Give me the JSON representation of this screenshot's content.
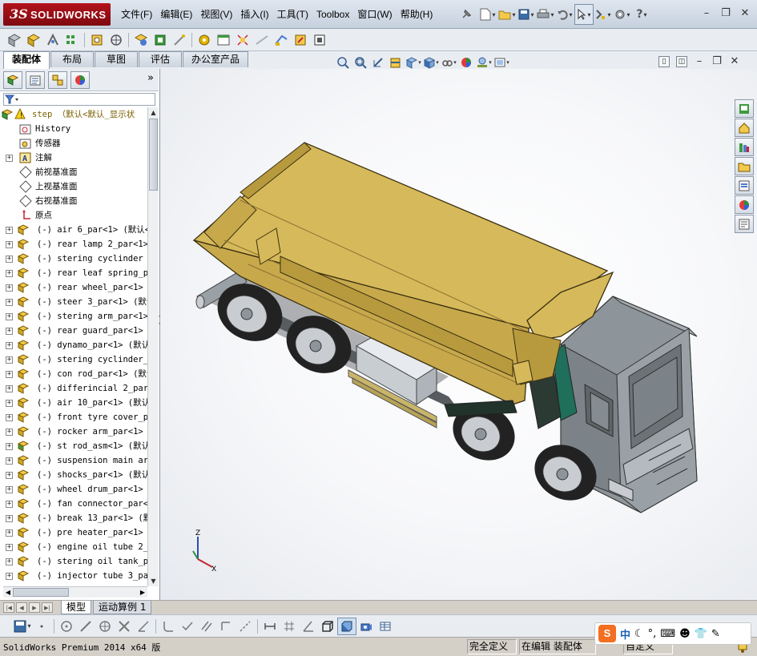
{
  "app": {
    "logo_ds": "3S",
    "logo_text": "SOLIDWORKS",
    "menus": [
      "文件(F)",
      "编辑(E)",
      "视图(V)",
      "插入(I)",
      "工具(T)",
      "Toolbox",
      "窗口(W)",
      "帮助(H)"
    ]
  },
  "command_tabs": [
    "装配体",
    "布局",
    "草图",
    "评估",
    "办公室产品"
  ],
  "active_command_tab": "装配体",
  "feature_tree": {
    "root": "step （默认<默认_显示状",
    "system_items": [
      "History",
      "传感器",
      "注解",
      "前视基准面",
      "上视基准面",
      "右视基准面",
      "原点"
    ],
    "components": [
      "(-) air 6_par<1> (默认<",
      "(-) rear lamp 2_par<1>",
      "(-) stering cyclinder r",
      "(-) rear leaf spring_pa",
      "(-) rear wheel_par<1> (",
      "(-) steer 3_par<1> (默认",
      "(-) stering arm_par<1>",
      "(-) rear guard_par<1> (",
      "(-) dynamo_par<1> (默认",
      "(-) stering cyclinder_p",
      "(-) con rod_par<1> (默认",
      "(-) differincial 2_par<",
      "(-) air 10_par<1> (默认",
      "(-) front tyre cover_pa",
      "(-) rocker arm_par<1> (",
      "(-) st rod_asm<1> (默认",
      "(-) suspension main arm",
      "(-) shocks_par<1> (默认",
      "(-) wheel drum_par<1> (",
      "(-) fan connector_par<1",
      "(-) break 13_par<1> (默",
      "(-) pre heater_par<1> (",
      "(-) engine oil tube 2_p",
      "(-) stering oil tank_pa",
      "(-) injector tube 3_par"
    ]
  },
  "bottom_tabs": [
    "模型",
    "运动算例 1"
  ],
  "active_bottom_tab": "模型",
  "status": {
    "product": "SolidWorks Premium 2014 x64 版",
    "definition": "完全定义",
    "mode": "在编辑 装配体",
    "customize": "自定义"
  },
  "ime": {
    "logo": "S",
    "lang": "中"
  },
  "triad": {
    "z": "Z",
    "x": "X"
  },
  "colors": {
    "accent_red": "#b3121b",
    "body_yellow": "#d6b95a",
    "cab_grey": "#8e959a"
  }
}
